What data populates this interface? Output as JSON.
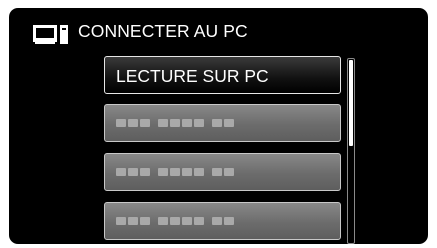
{
  "header": {
    "title": "CONNECTER AU PC",
    "icon": "computer-monitor-icon"
  },
  "menu": {
    "items": [
      {
        "label": "LECTURE SUR PC",
        "selected": true
      },
      {
        "label": "",
        "selected": false,
        "blurred": true
      },
      {
        "label": "",
        "selected": false,
        "blurred": true
      },
      {
        "label": "",
        "selected": false,
        "blurred": true
      }
    ]
  },
  "scrollbar": {
    "position": 0.0,
    "visible_fraction": 0.46
  },
  "colors": {
    "background": "#000000",
    "text": "#ffffff",
    "item_normal": "#6c6c6c",
    "item_selected": "#111111"
  }
}
